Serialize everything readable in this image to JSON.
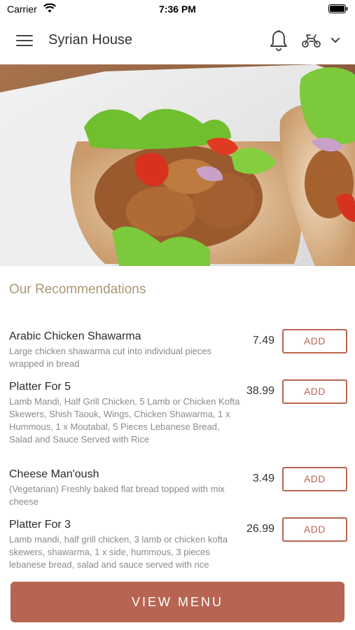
{
  "status_bar": {
    "carrier": "Carrier",
    "time": "7:36 PM"
  },
  "nav": {
    "title": "Syrian House"
  },
  "section": {
    "title": "Our Recommendations"
  },
  "items": [
    {
      "name": "Arabic Chicken Shawarma",
      "description": "Large chicken shawarma cut into individual pieces wrapped in bread",
      "price": "7.49",
      "button": "ADD"
    },
    {
      "name": "Platter For 5",
      "description": "Lamb Mandi, Half Grill Chicken, 5 Lamb or Chicken Kofta Skewers, Shish Taouk, Wings, Chicken Shawarma, 1 x Hummous, 1 x Moutabal, 5 Pieces Lebanese Bread, Salad and Sauce Served with Rice",
      "price": "38.99",
      "button": "ADD"
    },
    {
      "name": "Cheese Man'oush",
      "description": "(Vegetarian) Freshly baked flat bread topped with mix cheese",
      "price": "3.49",
      "button": "ADD"
    },
    {
      "name": "Platter For 3",
      "description": "Lamb mandi, half grill chicken, 3 lamb or chicken kofta skewers, shawarma, 1 x side, hummous, 3 pieces lebanese bread, salad and sauce served with rice",
      "price": "26.99",
      "button": "ADD"
    }
  ],
  "footer": {
    "button": "VIEW MENU"
  },
  "colors": {
    "accent": "#b76550",
    "section_title": "#a99771"
  },
  "icons": [
    "wifi-icon",
    "battery-icon",
    "hamburger-menu-icon",
    "bell-icon",
    "scooter-icon",
    "chevron-down-icon"
  ]
}
